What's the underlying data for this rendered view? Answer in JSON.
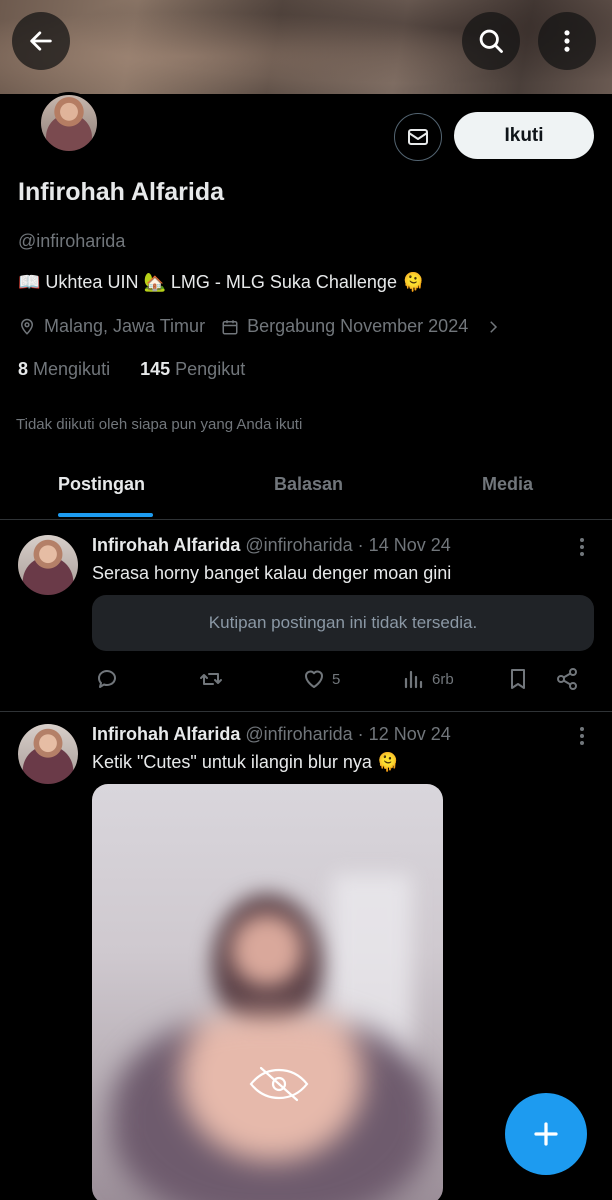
{
  "header": {
    "back_icon": "arrow-left-icon",
    "search_icon": "search-icon",
    "more_icon": "more-vertical-icon"
  },
  "profile": {
    "message_icon": "mail-icon",
    "follow_label": "Ikuti",
    "name": "Infirohah Alfarida",
    "handle": "@infiroharida",
    "bio": "📖 Ukhtea UIN 🏡 LMG - MLG  Suka Challenge 🫠",
    "location": "Malang, Jawa Timur",
    "joined": "Bergabung November 2024",
    "following_count": "8",
    "following_label": "Mengikuti",
    "followers_count": "145",
    "followers_label": "Pengikut",
    "not_followed_text": "Tidak diikuti oleh siapa pun yang Anda ikuti"
  },
  "tabs": [
    {
      "label": "Postingan",
      "active": true
    },
    {
      "label": "Balasan",
      "active": false
    },
    {
      "label": "Media",
      "active": false
    }
  ],
  "posts": [
    {
      "name": "Infirohah Alfarida",
      "meta": "@infiroharida · 14 Nov 24",
      "text": "Serasa horny banget kalau denger moan gini",
      "quote_unavailable": "Kutipan postingan ini tidak tersedia.",
      "likes": "5",
      "views": "6rb"
    },
    {
      "name": "Infirohah Alfarida",
      "meta": "@infiroharida · 12 Nov 24",
      "text": "Ketik \"Cutes\" untuk ilangin blur nya 🫠"
    }
  ],
  "fab": {
    "icon": "plus-icon"
  },
  "colors": {
    "accent": "#1d9bf0",
    "background": "#000000",
    "muted": "#71767b",
    "text": "#e7e9ea"
  }
}
